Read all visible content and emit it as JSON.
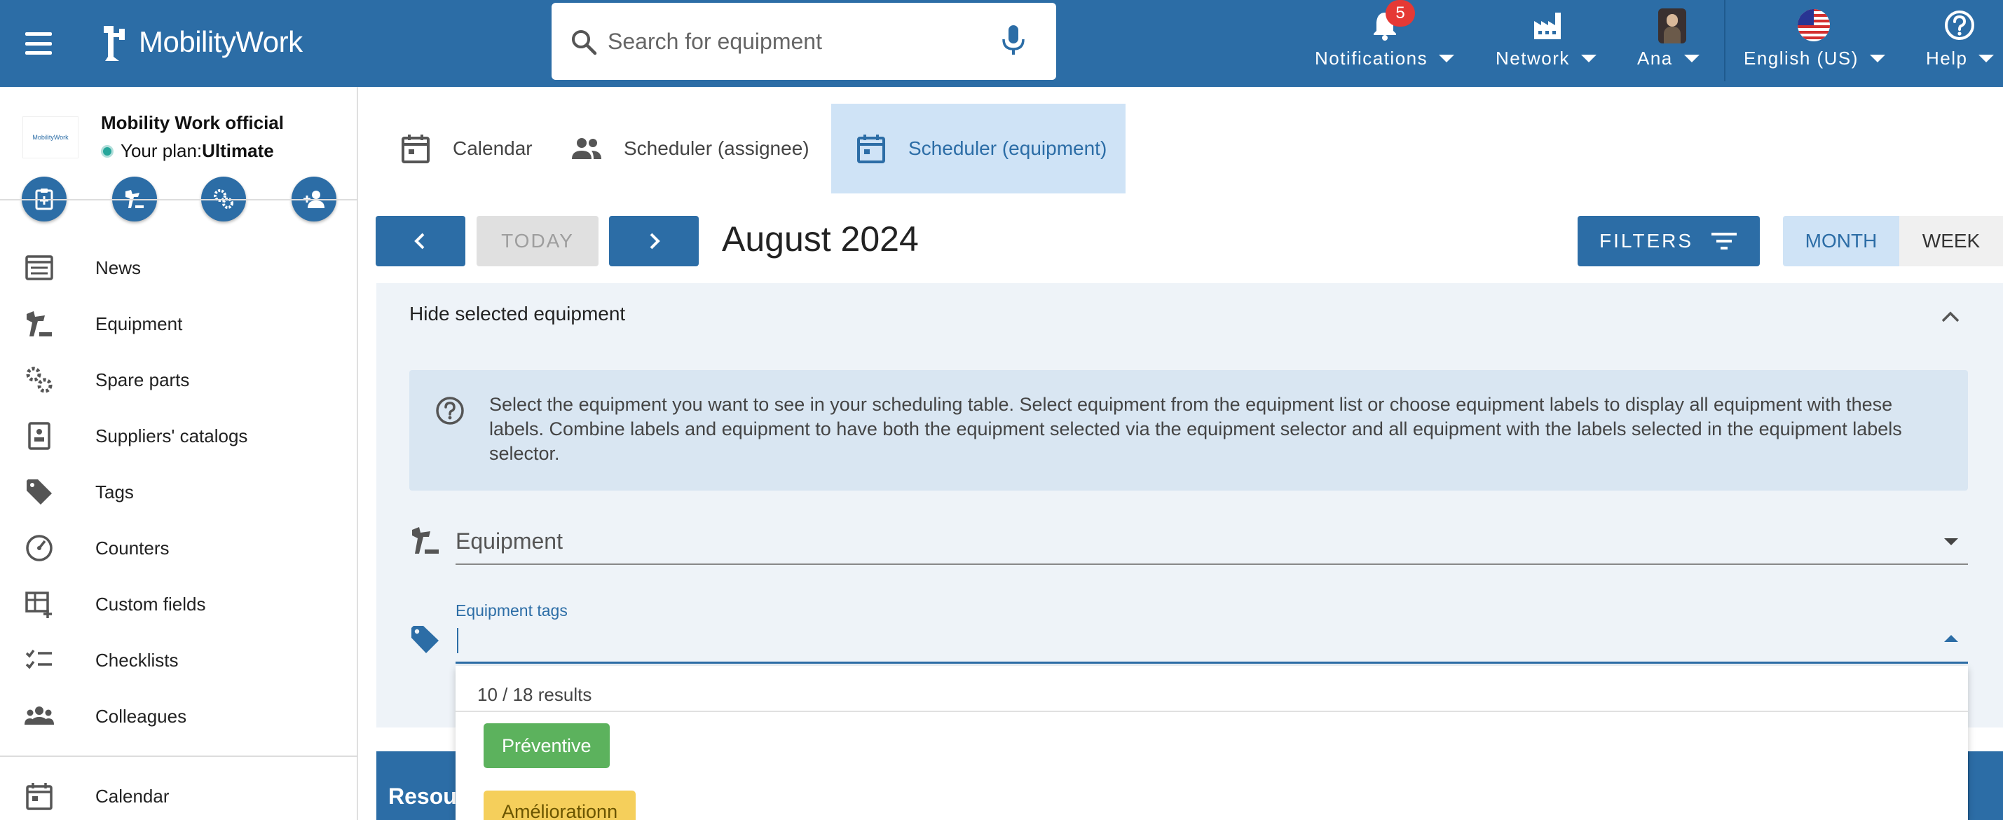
{
  "header": {
    "logo_text": "MobilityWork",
    "search_placeholder": "Search for equipment",
    "notifications": {
      "label": "Notifications",
      "count": "5"
    },
    "network_label": "Network",
    "user_label": "Ana",
    "language_label": "English (US)",
    "help_label": "Help"
  },
  "sidebar": {
    "org_name": "Mobility Work official",
    "plan_prefix": "Your plan:",
    "plan_value": "Ultimate",
    "items": [
      {
        "label": "News",
        "icon": "news-icon"
      },
      {
        "label": "Equipment",
        "icon": "equipment-icon"
      },
      {
        "label": "Spare parts",
        "icon": "spare-parts-icon"
      },
      {
        "label": "Suppliers' catalogs",
        "icon": "catalog-icon"
      },
      {
        "label": "Tags",
        "icon": "tag-icon"
      },
      {
        "label": "Counters",
        "icon": "counter-icon"
      },
      {
        "label": "Custom fields",
        "icon": "custom-fields-icon"
      },
      {
        "label": "Checklists",
        "icon": "checklist-icon"
      },
      {
        "label": "Colleagues",
        "icon": "colleagues-icon"
      },
      {
        "label": "Calendar",
        "icon": "calendar-icon"
      }
    ]
  },
  "tabs": [
    {
      "label": "Calendar"
    },
    {
      "label": "Scheduler (assignee)"
    },
    {
      "label": "Scheduler (equipment)"
    }
  ],
  "toolbar": {
    "today_label": "TODAY",
    "month_title": "August 2024",
    "filters_label": "FILTERS",
    "month_label": "MONTH",
    "week_label": "WEEK"
  },
  "panel": {
    "header": "Hide selected equipment",
    "info_text": "Select the equipment you want to see in your scheduling table. Select equipment from the equipment list or choose equipment labels to display all equipment with these labels. Combine labels and equipment to have both the equipment selected via the equipment selector and all equipment with the labels selected in the equipment labels selector.",
    "equipment_label": "Equipment",
    "tags_label": "Equipment tags"
  },
  "dropdown": {
    "results": "10 / 18 results",
    "chips": [
      {
        "label": "Préventive",
        "color": "#5cb25d"
      },
      {
        "label": "Améliorationn",
        "color": "#f5cf5b"
      }
    ]
  },
  "resource_header": "Resou",
  "colors": {
    "primary": "#2c6da6",
    "active_tab": "#cfe3f6",
    "panel_bg": "#eef3f8"
  }
}
